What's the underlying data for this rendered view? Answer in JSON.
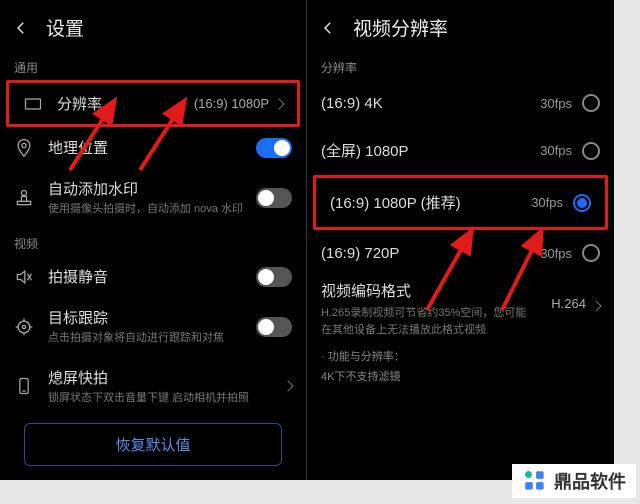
{
  "left": {
    "title": "设置",
    "section_general": "通用",
    "resolution_label": "分辨率",
    "resolution_value": "(16:9) 1080P",
    "geo_label": "地理位置",
    "watermark_label": "自动添加水印",
    "watermark_sub": "使用摄像头拍摄时，自动添加 nova 水印",
    "section_video": "视频",
    "mute_label": "拍摄静音",
    "tracking_label": "目标跟踪",
    "tracking_sub": "点击拍摄对象将自动进行跟踪和对焦",
    "screenoff_label": "熄屏快拍",
    "screenoff_sub": "锁屏状态下双击音量下键  启动相机并拍照",
    "restore_label": "恢复默认值"
  },
  "right": {
    "title": "视频分辨率",
    "section_res": "分辨率",
    "options": [
      {
        "label": "(16:9) 4K",
        "fps": "30fps",
        "selected": false
      },
      {
        "label": "(全屏) 1080P",
        "fps": "30fps",
        "selected": false
      },
      {
        "label": "(16:9) 1080P (推荐)",
        "fps": "30fps",
        "selected": true
      },
      {
        "label": "(16:9) 720P",
        "fps": "30fps",
        "selected": false
      }
    ],
    "encoding_title": "视频编码格式",
    "encoding_sub": "H.265录制视频可节省约35%空间，您可能在其他设备上无法播放此格式视频",
    "encoding_value": "H.264",
    "note1": "· 功能与分辨率：",
    "note2": "  4K下不支持滤镜"
  },
  "watermark_text": "鼎品软件"
}
